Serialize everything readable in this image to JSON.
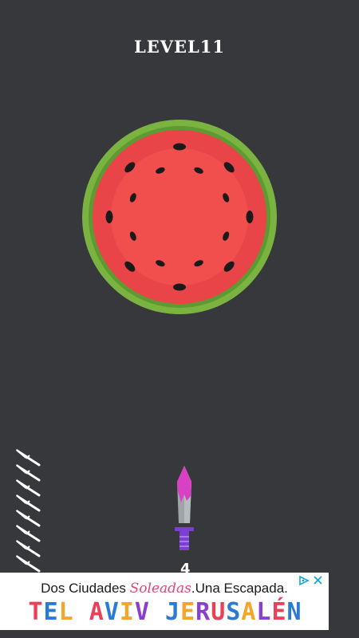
{
  "game": {
    "level_title": "LEVEL11",
    "knives_remaining": "4",
    "stacked_knives": 8,
    "target": {
      "type": "watermelon",
      "rind_color": "#7bb341",
      "flesh_color": "#e94448",
      "center_color": "#f04f4d",
      "seed_color": "#1b1b1b",
      "seeds": 16
    },
    "knife_colors": {
      "blade": "#9ea4a8",
      "juice": "#d941c4",
      "handle": "#7b3fd6"
    },
    "icons": [
      "knife-icon",
      "ad-choices-icon",
      "close-icon"
    ]
  },
  "ad": {
    "line1_start": "Dos Ciudades ",
    "line1_accent": "Soleadas",
    "line1_end": ".Una Escapada.",
    "line2": "TEL AVIV JERUSALÉN"
  },
  "colors": {
    "background": "#37383c"
  }
}
